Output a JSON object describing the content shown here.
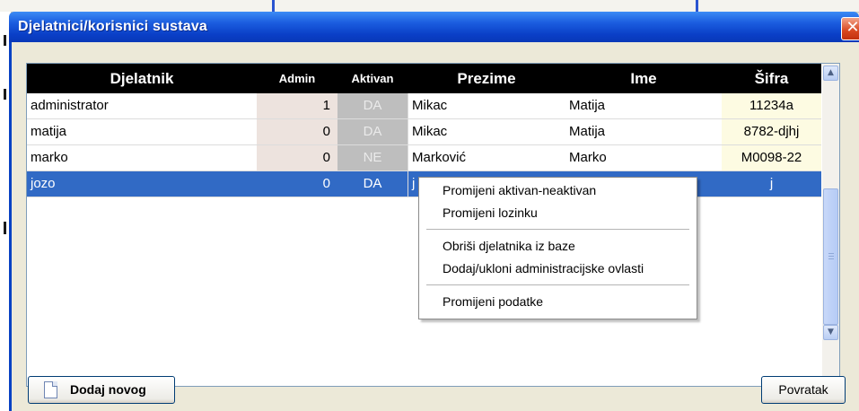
{
  "window": {
    "title": "Djelatnici/korisnici sustava",
    "close_glyph": "✕"
  },
  "grid": {
    "columns": [
      "Djelatnik",
      "Admin",
      "Aktivan",
      "Prezime",
      "Ime",
      "Šifra"
    ],
    "rows": [
      {
        "djelatnik": "administrator",
        "admin": "1",
        "aktivan": "DA",
        "prezime": "Mikac",
        "ime": "Matija",
        "sifra": "11234a"
      },
      {
        "djelatnik": "matija",
        "admin": "0",
        "aktivan": "DA",
        "prezime": "Mikac",
        "ime": "Matija",
        "sifra": "8782-djhj"
      },
      {
        "djelatnik": "marko",
        "admin": "0",
        "aktivan": "NE",
        "prezime": "Marković",
        "ime": "Marko",
        "sifra": "M0098-22"
      },
      {
        "djelatnik": "jozo",
        "admin": "0",
        "aktivan": "DA",
        "prezime": "j",
        "ime": "",
        "sifra": "j"
      }
    ],
    "selected_row": "jozo"
  },
  "scrollbar": {
    "up_icon": "chevron-up-icon",
    "down_icon": "chevron-down-icon"
  },
  "context_menu": {
    "items": [
      "Promijeni aktivan-neaktivan",
      "Promijeni lozinku",
      "Obriši djelatnika iz baze",
      "Dodaj/ukloni administracijske ovlasti",
      "Promijeni podatke"
    ]
  },
  "buttons": {
    "add": "Dodaj novog",
    "add_icon": "document-icon",
    "back": "Povratak"
  },
  "colors": {
    "title_bar": "#0a3fc7",
    "selection": "#316ac5",
    "header_bg": "#000000"
  }
}
